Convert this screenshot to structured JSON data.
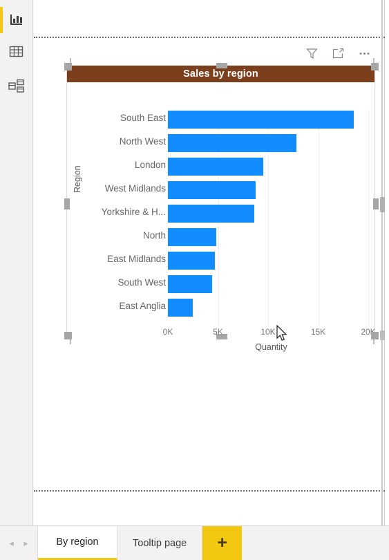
{
  "app": {
    "accent_yellow": "#f2c811",
    "bar_color": "#118dff",
    "title_bar_color": "#7c3f1d"
  },
  "sidebar": {
    "items": [
      {
        "label": "Report view",
        "icon": "bar-chart-icon",
        "active": true
      },
      {
        "label": "Data view",
        "icon": "table-grid-icon",
        "active": false
      },
      {
        "label": "Model view",
        "icon": "model-relationships-icon",
        "active": false
      }
    ]
  },
  "visual_header": {
    "buttons": [
      {
        "label": "Filters",
        "icon": "filter-funnel-icon"
      },
      {
        "label": "Focus mode",
        "icon": "focus-mode-icon"
      },
      {
        "label": "More options",
        "icon": "more-options-ellipsis-icon"
      }
    ]
  },
  "visual": {
    "title": "Sales by region"
  },
  "chart_data": {
    "type": "bar",
    "orientation": "horizontal",
    "title": "Sales by region",
    "xlabel": "Quantity",
    "ylabel": "Region",
    "xlim": [
      0,
      20000
    ],
    "xticks": [
      0,
      5000,
      10000,
      15000,
      20000
    ],
    "xtick_labels": [
      "0K",
      "5K",
      "10K",
      "15K",
      "20K"
    ],
    "grid": true,
    "grid_axis": "x",
    "legend": null,
    "series_color": "#118dff",
    "categories": [
      "South East",
      "North West",
      "London",
      "West Midlands",
      "Yorkshire & H...",
      "North",
      "East Midlands",
      "South West",
      "East Anglia"
    ],
    "values": [
      18550,
      12830,
      9520,
      8790,
      8620,
      4830,
      4720,
      4410,
      2480
    ]
  },
  "tabbar": {
    "prev_label": "◂",
    "next_label": "▸",
    "tabs": [
      {
        "label": "By region",
        "active": true
      },
      {
        "label": "Tooltip page",
        "active": false
      }
    ],
    "add_label": "+"
  }
}
